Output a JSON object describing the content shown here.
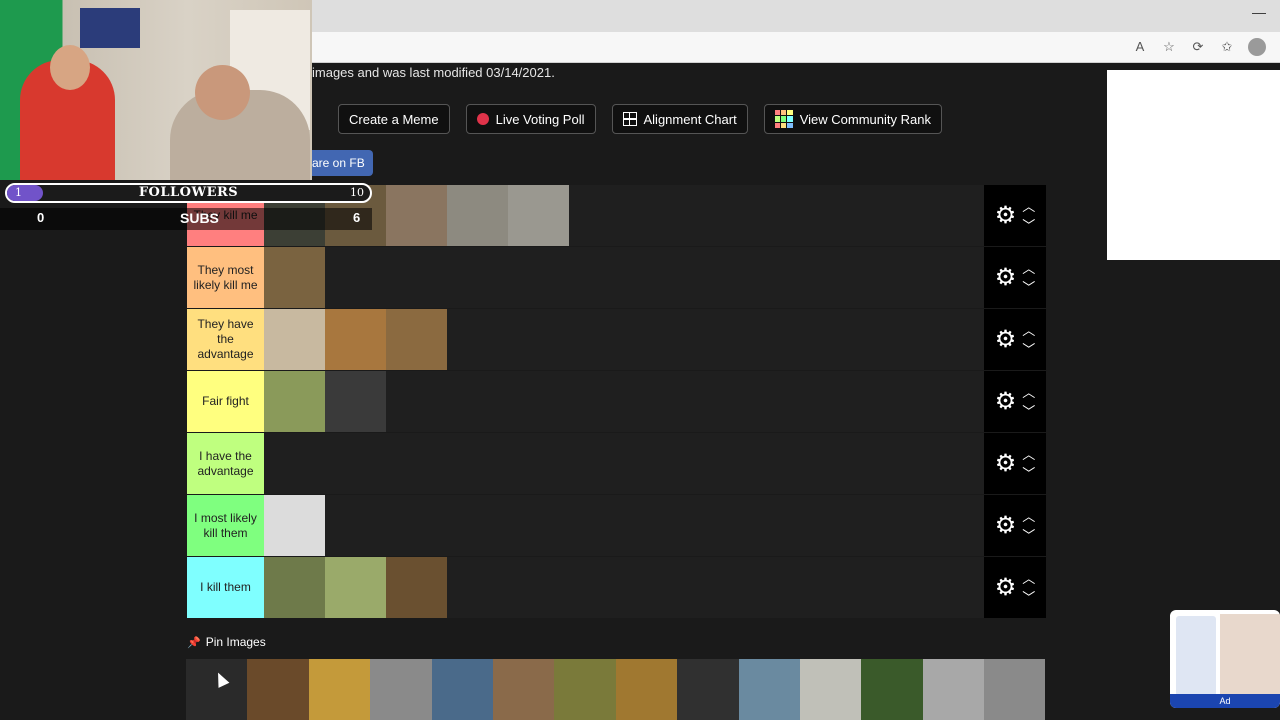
{
  "page": {
    "info_text": "images and was last modified 03/14/2021.",
    "buttons": [
      {
        "label": "Create a Meme",
        "icon": "none"
      },
      {
        "label": "Live Voting Poll",
        "icon": "red-dot-icon"
      },
      {
        "label": "Alignment Chart",
        "icon": "grid-icon"
      },
      {
        "label": "View Community Rank",
        "icon": "color-grid-icon"
      }
    ],
    "share_label": "are on FB",
    "pin_label": "Pin Images"
  },
  "tiers": [
    {
      "label": "They kill me",
      "color": "#ff7f7f",
      "items": [
        "#3c3f35",
        "#6b5a3e",
        "#8a7560",
        "#8d8a80",
        "#9a9890"
      ]
    },
    {
      "label": "They most likely kill me",
      "color": "#ffbf7f",
      "items": [
        "#7a6340"
      ]
    },
    {
      "label": "They have the advantage",
      "color": "#ffdf7f",
      "items": [
        "#c8b9a0",
        "#a8773e",
        "#8b6a40"
      ]
    },
    {
      "label": "Fair fight",
      "color": "#ffff7f",
      "items": [
        "#8a9a5a",
        "#3a3a3a"
      ]
    },
    {
      "label": "I have the advantage",
      "color": "#bfff7f",
      "items": []
    },
    {
      "label": "I most likely kill them",
      "color": "#7fff7f",
      "items": [
        "#dcdcdc"
      ]
    },
    {
      "label": "I kill them",
      "color": "#7fffff",
      "items": [
        "#6e7a4a",
        "#9aaa6a",
        "#6a5030"
      ]
    }
  ],
  "pool": [
    "#2a2a2a",
    "#6a4a2a",
    "#c49a3a",
    "#8a8a8a",
    "#4a6a8a",
    "#8a6a4a",
    "#7a7a3a",
    "#a07830",
    "#303030",
    "#6a8aa0",
    "#c0c0b8",
    "#3a5a2a",
    "#a8a8a8",
    "#8a8a8a"
  ],
  "overlay": {
    "followers_label": "FOLLOWERS",
    "followers_min": "1",
    "followers_max": "10",
    "followers_progress": 0.1,
    "subs_label": "SUBS",
    "subs_current": "0",
    "subs_goal": "6"
  },
  "ad": {
    "bottom_label": "Ad"
  }
}
